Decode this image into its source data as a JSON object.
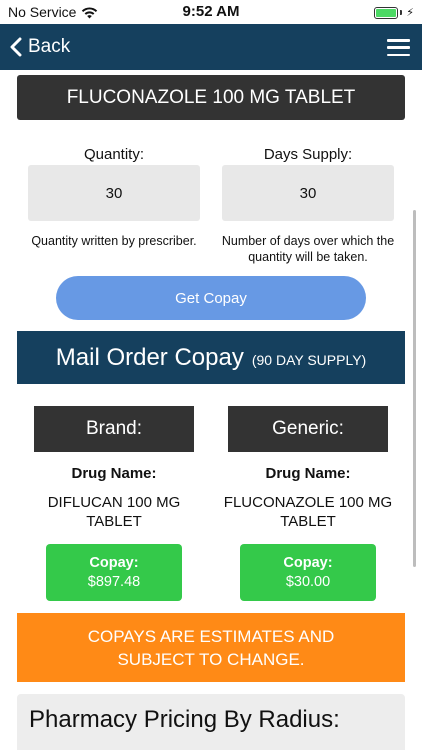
{
  "status_bar": {
    "carrier": "No Service",
    "time": "9:52 AM",
    "battery_level": 1.0
  },
  "nav": {
    "back_label": "Back",
    "icons": {
      "back": "chevron-left-icon",
      "menu": "hamburger-menu-icon"
    }
  },
  "drug": {
    "title": "FLUCONAZOLE 100 MG TABLET"
  },
  "quantity": {
    "label": "Quantity:",
    "value": "30",
    "help": "Quantity written by prescriber."
  },
  "days_supply": {
    "label": "Days Supply:",
    "value": "30",
    "help": "Number of days over which the quantity will be taken."
  },
  "get_copay_label": "Get Copay",
  "mail_order": {
    "title": "Mail Order Copay",
    "subtitle": "(90 DAY SUPPLY)",
    "brand": {
      "header": "Brand:",
      "drug_name_label": "Drug Name:",
      "drug_name": "DIFLUCAN 100 MG TABLET",
      "copay_label": "Copay:",
      "copay_value": "$897.48"
    },
    "generic": {
      "header": "Generic:",
      "drug_name_label": "Drug Name:",
      "drug_name": "FLUCONAZOLE 100 MG TABLET",
      "copay_label": "Copay:",
      "copay_value": "$30.00"
    }
  },
  "disclaimer": "COPAYS ARE ESTIMATES AND SUBJECT TO CHANGE.",
  "pharmacy_radius": {
    "title": "Pharmacy Pricing By Radius:"
  },
  "colors": {
    "nav_bg": "#15405e",
    "dark_header": "#333333",
    "copay_button": "#6799e4",
    "price_button": "#34c94a",
    "disclaimer_bg": "#ff8a16",
    "input_bg": "#e8e8e8"
  }
}
